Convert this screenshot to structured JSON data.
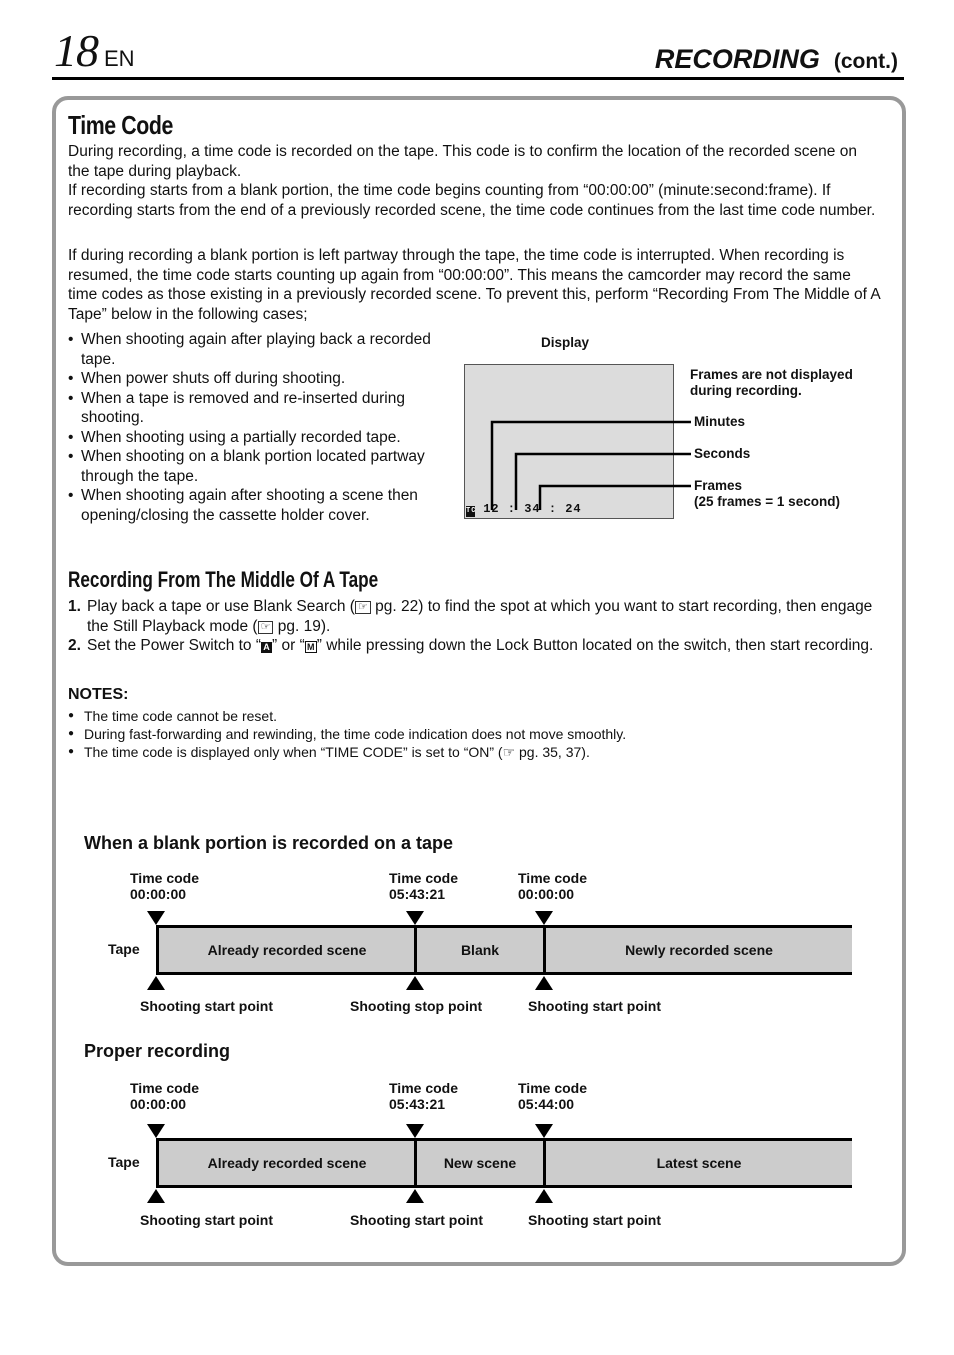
{
  "header": {
    "page_number": "18",
    "lang": "EN",
    "section": "RECORDING",
    "cont": "(cont.)"
  },
  "time_code": {
    "title": "Time Code",
    "para1_l1": "During recording, a time code is recorded on the tape. This code is to confirm the location of the recorded scene on the tape during playback.",
    "para1_l2": "If recording starts from a blank portion, the time code begins counting from “00:00:00” (minute:second:frame). If recording starts from the end of a previously recorded scene, the time code continues from the last time code number.",
    "para2": "If during recording a blank portion is left partway through the tape, the time code is interrupted. When recording is resumed, the time code starts counting up again from “00:00:00”. This means the camcorder may record the same time codes as those existing in a previously recorded scene. To prevent this, perform “Recording From The Middle of A Tape” below in the following cases;",
    "cases": [
      "When shooting again after playing back a recorded tape.",
      "When power shuts off during shooting.",
      "When a tape is removed and re-inserted during shooting.",
      "When shooting using a partially recorded tape.",
      "When shooting on a blank portion located partway through the tape.",
      "When shooting again after shooting a scene then opening/closing the cassette holder cover."
    ],
    "display": {
      "label": "Display",
      "timecode": "12 : 34 : 24",
      "tc_icon": "TC",
      "note": "Frames are not displayed during recording.",
      "minutes": "Minutes",
      "seconds": "Seconds",
      "frames": "Frames",
      "frames_note": "(25 frames = 1 second)"
    }
  },
  "middle": {
    "title": "Recording From The Middle Of A Tape",
    "steps": [
      {
        "n": "1.",
        "a": "Play back a tape or use Blank Search (",
        "ref1": "☞",
        "b": " pg. 22) to find the spot at which you want to start recording, then engage the Still Playback mode (",
        "ref2": "☞",
        "c": " pg. 19)."
      },
      {
        "n": "2.",
        "a": "Set the Power Switch to “",
        "key1": "A",
        "b": "” or “",
        "key2": "M",
        "c": "” while pressing down the Lock Button located on the switch, then start recording."
      }
    ]
  },
  "notes": {
    "title": "NOTES:",
    "items": [
      "The time code cannot be reset.",
      "During fast-forwarding and rewinding, the time code indication does not move smoothly.",
      "The time code is displayed only when “TIME CODE” is set to “ON” (☞ pg. 35, 37)."
    ]
  },
  "diagram1": {
    "title": "When a blank portion is recorded on a tape",
    "tape_label": "Tape",
    "top": [
      {
        "l1": "Time code",
        "l2": "00:00:00"
      },
      {
        "l1": "Time code",
        "l2": "05:43:21"
      },
      {
        "l1": "Time code",
        "l2": "00:00:00"
      }
    ],
    "segments": [
      "Already recorded scene",
      "Blank",
      "Newly recorded scene"
    ],
    "bottom": [
      "Shooting start point",
      "Shooting stop point",
      "Shooting start point"
    ]
  },
  "diagram2": {
    "title": "Proper recording",
    "tape_label": "Tape",
    "top": [
      {
        "l1": "Time code",
        "l2": "00:00:00"
      },
      {
        "l1": "Time code",
        "l2": "05:43:21"
      },
      {
        "l1": "Time code",
        "l2": "05:44:00"
      }
    ],
    "segments": [
      "Already recorded scene",
      "New scene",
      "Latest scene"
    ],
    "bottom": [
      "Shooting start point",
      "Shooting start point",
      "Shooting start point"
    ]
  }
}
